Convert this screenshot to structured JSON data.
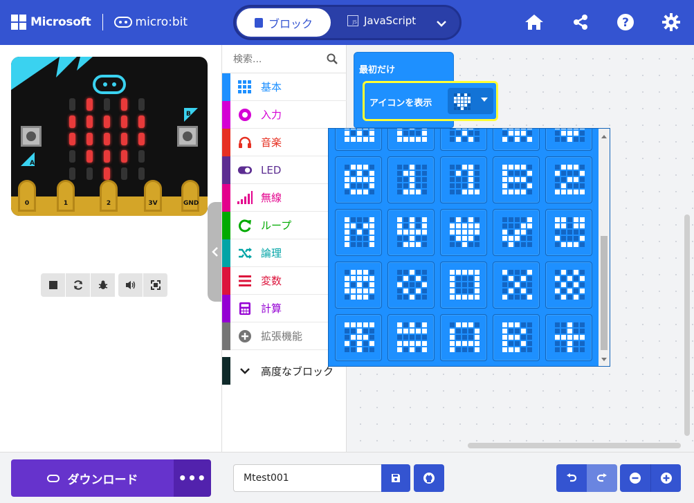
{
  "header": {
    "brand_microsoft": "Microsoft",
    "brand_product": "micro:bit",
    "tab_blocks": "ブロック",
    "tab_javascript": "JavaScript",
    "js_icon_text": "JS"
  },
  "icons": {
    "home": "home-icon",
    "share": "share-icon",
    "help": "help-icon",
    "settings": "gear-icon"
  },
  "simulator": {
    "pin_labels": [
      "0",
      "1",
      "2",
      "3V",
      "GND"
    ],
    "button_a": "A",
    "button_b": "B",
    "led_matrix": [
      [
        0,
        1,
        0,
        1,
        0
      ],
      [
        1,
        1,
        1,
        1,
        1
      ],
      [
        1,
        1,
        1,
        1,
        1
      ],
      [
        0,
        1,
        1,
        1,
        0
      ],
      [
        0,
        0,
        1,
        0,
        0
      ]
    ],
    "controls": [
      "stop-icon",
      "restart-icon",
      "debug-icon",
      "sound-icon",
      "fullscreen-icon"
    ]
  },
  "toolbox": {
    "search_placeholder": "検索...",
    "categories": [
      {
        "label": "基本",
        "color": "#1e90ff"
      },
      {
        "label": "入力",
        "color": "#d400d4"
      },
      {
        "label": "音楽",
        "color": "#e63022"
      },
      {
        "label": "LED",
        "color": "#5c2d91"
      },
      {
        "label": "無線",
        "color": "#e3008c"
      },
      {
        "label": "ループ",
        "color": "#00aa00"
      },
      {
        "label": "論理",
        "color": "#00a4a6"
      },
      {
        "label": "変数",
        "color": "#dc143c"
      },
      {
        "label": "計算",
        "color": "#9400d3"
      },
      {
        "label": "拡張機能",
        "color": "#757575"
      }
    ],
    "advanced_label": "高度なブロック"
  },
  "workspace": {
    "hat_block_label": "最初だけ",
    "show_icon_label": "アイコンを表示",
    "selected_icon": "heart"
  },
  "footer": {
    "download_label": "ダウンロード",
    "more_label": "•••",
    "project_name": "Mtest001"
  },
  "colors": {
    "header": "#3454d1",
    "block_blue": "#1e90ff",
    "download": "#6633cc",
    "led_on": "#e83a3a"
  }
}
